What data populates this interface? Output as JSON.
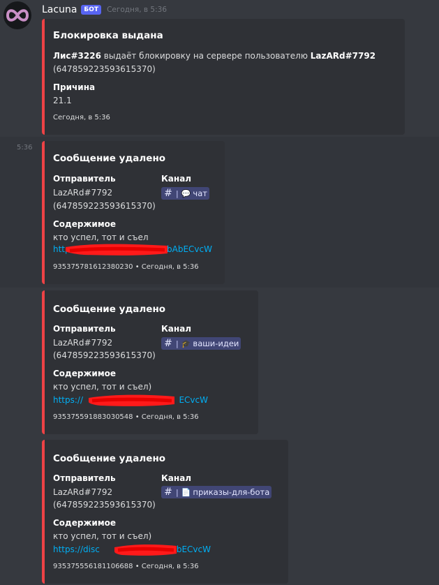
{
  "message": {
    "author": "Lacuna",
    "bot_tag": "БОТ",
    "timestamp": "Сегодня, в 5:36",
    "side_time": "5:36"
  },
  "ban_embed": {
    "title": "Блокировка выдана",
    "moderator": "Лис#3226",
    "action_text": "выдаёт блокировку на сервере пользователю",
    "target": "LazARd#7792",
    "target_id": "(647859223593615370)",
    "reason_label": "Причина",
    "reason": "21.1",
    "footer": "Сегодня, в 5:36"
  },
  "deleted_embeds": [
    {
      "title": "Сообщение удалено",
      "sender_label": "Отправитель",
      "sender": "LazARd#7792",
      "sender_id": "(647859223593615370)",
      "channel_label": "Канал",
      "channel_hash": "#",
      "channel_sep": "|",
      "channel_emoji": "💬",
      "channel_name": "чат",
      "content_label": "Содержимое",
      "content": "кто успел, тот и съел",
      "link_prefix": "https",
      "link_suffix": "bAbECvcW",
      "footer": "935375781612380230 • Сегодня, в 5:36"
    },
    {
      "title": "Сообщение удалено",
      "sender_label": "Отправитель",
      "sender": "LazARd#7792",
      "sender_id": "(647859223593615370)",
      "channel_label": "Канал",
      "channel_hash": "#",
      "channel_sep": "|",
      "channel_emoji": "🎓",
      "channel_name": "ваши-идеи",
      "content_label": "Содержимое",
      "content": "кто успел, тот и съел)",
      "link_prefix": "https://",
      "link_suffix": "ECvcW",
      "footer": "935375591883030548 • Сегодня, в 5:36"
    },
    {
      "title": "Сообщение удалено",
      "sender_label": "Отправитель",
      "sender": "LazARd#7792",
      "sender_id": "(647859223593615370)",
      "channel_label": "Канал",
      "channel_hash": "#",
      "channel_sep": "|",
      "channel_emoji": "📄",
      "channel_name": "приказы-для-бота",
      "content_label": "Содержимое",
      "content": "кто успел, тот и съел)",
      "link_prefix": "https://disc",
      "link_suffix": "AbECvcW",
      "footer": "935375556181106688 • Сегодня, в 5:36"
    }
  ],
  "colors": {
    "background": "#36393f",
    "embed_bg": "#2f3136",
    "embed_accent": "#ed4245",
    "link": "#00aff4",
    "bot_tag": "#5865f2",
    "channel_pill": "#414675",
    "redaction": "#ff1a1a"
  }
}
